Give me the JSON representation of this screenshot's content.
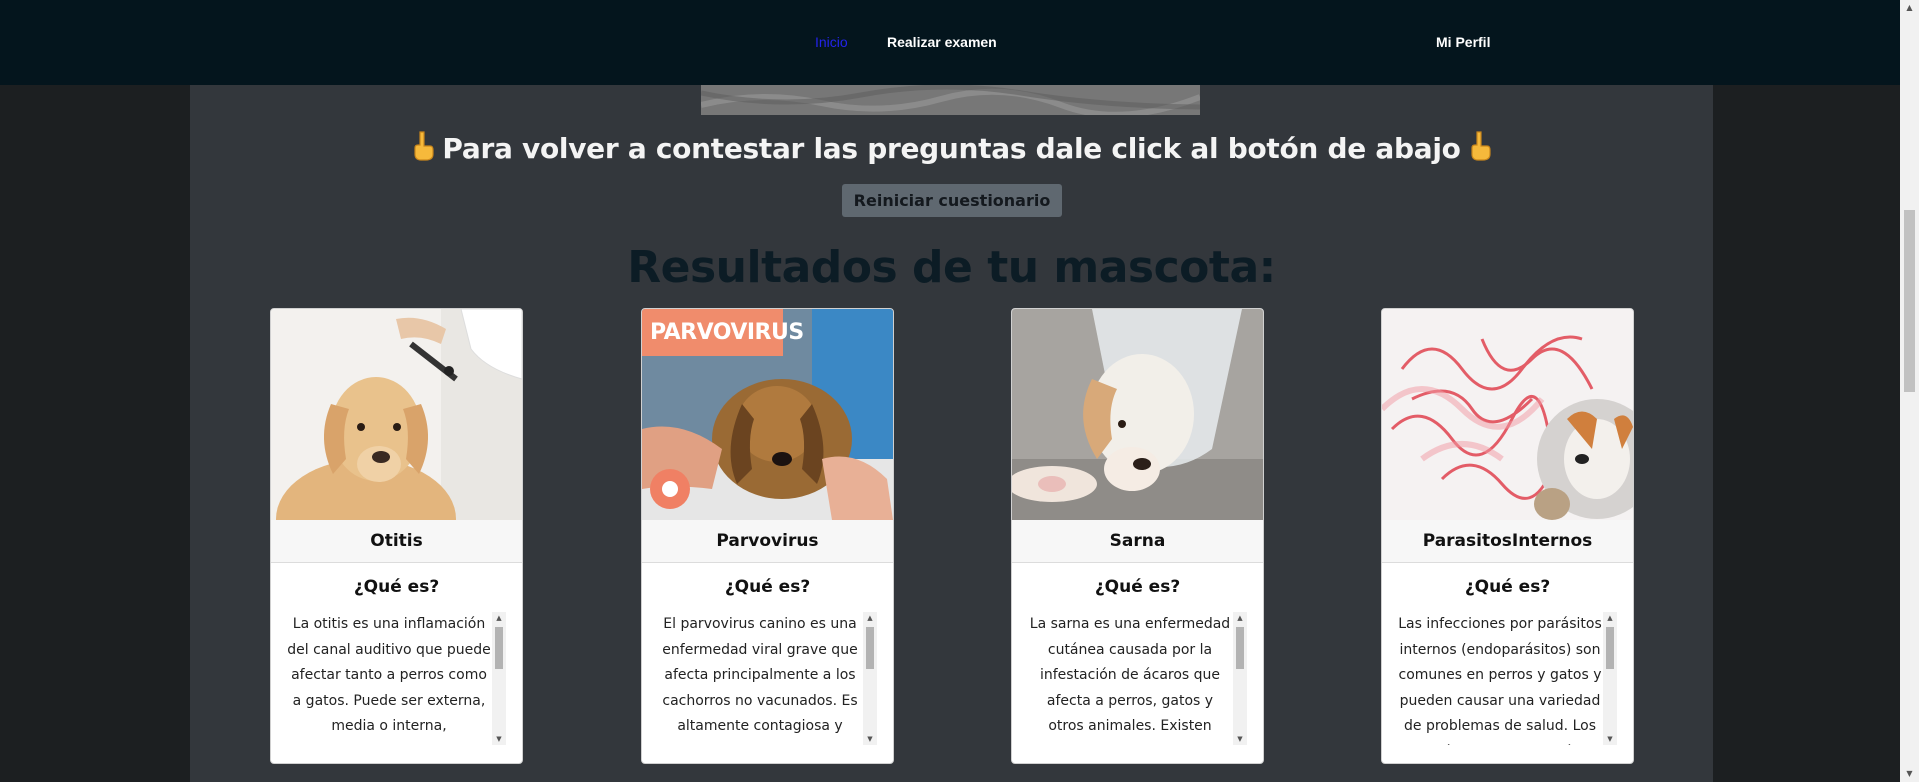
{
  "nav": {
    "links": [
      {
        "label": "Inicio",
        "active": true
      },
      {
        "label": "Realizar examen",
        "active": false
      }
    ],
    "profile": "Mi Perfil"
  },
  "retry": {
    "heading": "Para volver a contestar las preguntas dale click al botón de abajo",
    "icon": "pointing-down-hand-icon",
    "button": "Reiniciar cuestionario"
  },
  "results_title": "Resultados de tu mascota:",
  "cards": [
    {
      "name": "Otitis",
      "subtitle": "¿Qué es?",
      "text": "La otitis es una inflamación del canal auditivo que puede afectar tanto a perros como a gatos. Puede ser externa, media o interna, dependiendo de la parte del oído afectada.",
      "image": "dog-ear-exam-photo"
    },
    {
      "name": "Parvovirus",
      "subtitle": "¿Qué es?",
      "text": "El parvovirus canino es una enfermedad viral grave que afecta principalmente a los cachorros no vacunados. Es altamente contagiosa y puede ser mortal.",
      "image": "parvovirus-puppy-photo",
      "image_label": "PARVOVIRUS"
    },
    {
      "name": "Sarna",
      "subtitle": "¿Qué es?",
      "text": "La sarna es una enfermedad cutánea causada por la infestación de ácaros que afecta a perros, gatos y otros animales. Existen diferentes tipos de sarna dependiendo del ácaro.",
      "image": "dog-with-cone-photo"
    },
    {
      "name": "ParasitosInternos",
      "subtitle": "¿Qué es?",
      "text": "Las infecciones por parásitos internos (endoparásitos) son comunes en perros y gatos y pueden causar una variedad de problemas de salud. Los parásitos internos más comunes",
      "image": "internal-parasites-illustration"
    }
  ],
  "colors": {
    "navbar": "#04151d",
    "active_link": "#2323ea",
    "panel": "#33373c",
    "results_title": "#0c1c25",
    "button": "#5f6870"
  }
}
